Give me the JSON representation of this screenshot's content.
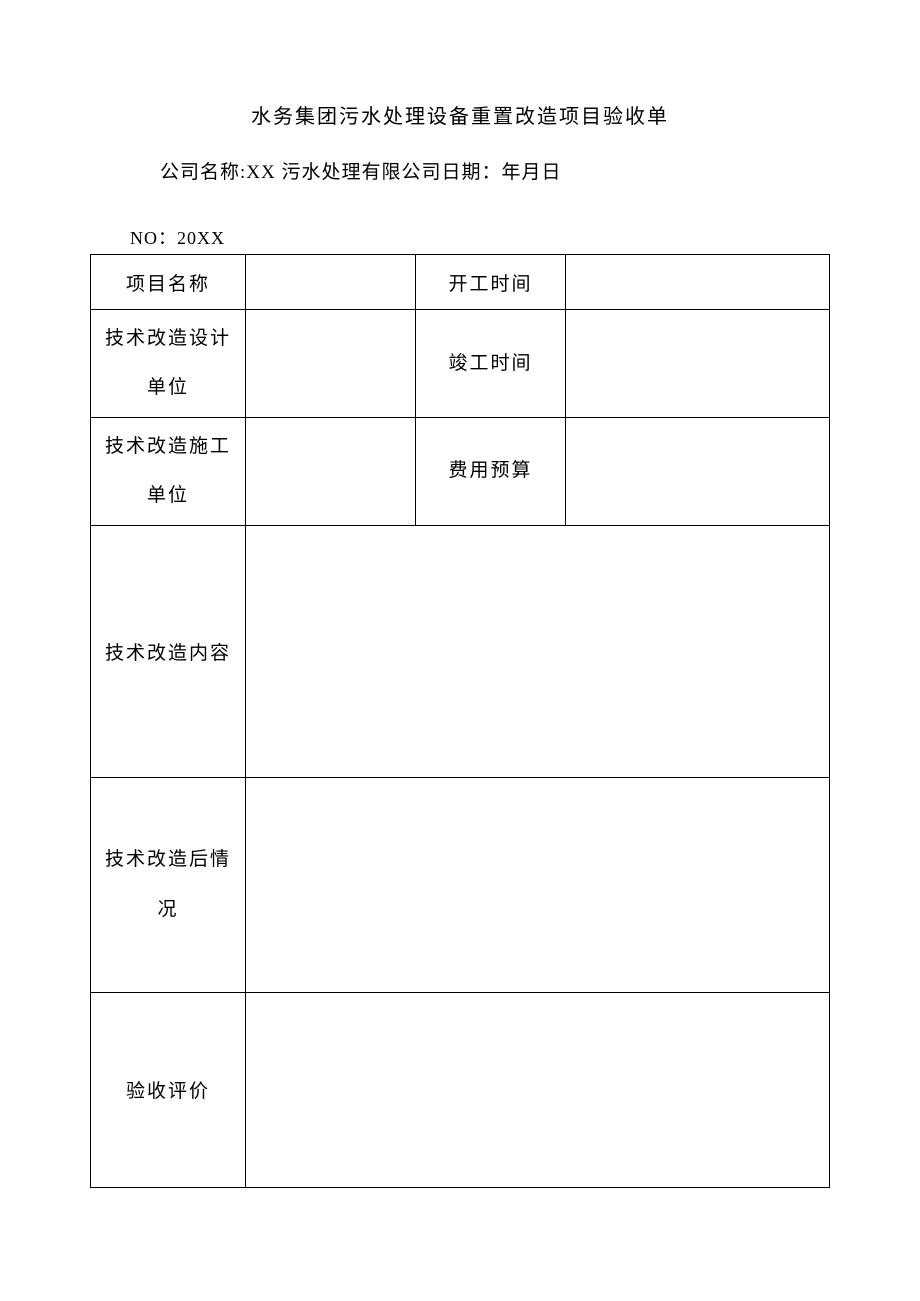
{
  "title": "水务集团污水处理设备重置改造项目验收单",
  "company_line": "公司名称:XX 污水处理有限公司日期：年月日",
  "doc_no": "NO：20XX",
  "table": {
    "project_name_label": "项目名称",
    "project_name_value": "",
    "start_time_label": "开工时间",
    "start_time_value": "",
    "design_unit_label": "技术改造设计单位",
    "design_unit_value": "",
    "end_time_label": "竣工时间",
    "end_time_value": "",
    "construction_unit_label": "技术改造施工单位",
    "construction_unit_value": "",
    "budget_label": "费用预算",
    "budget_value": "",
    "content_label": "技术改造内容",
    "content_value": "",
    "after_label": "技术改造后情况",
    "after_value": "",
    "evaluation_label": "验收评价",
    "evaluation_value": ""
  }
}
